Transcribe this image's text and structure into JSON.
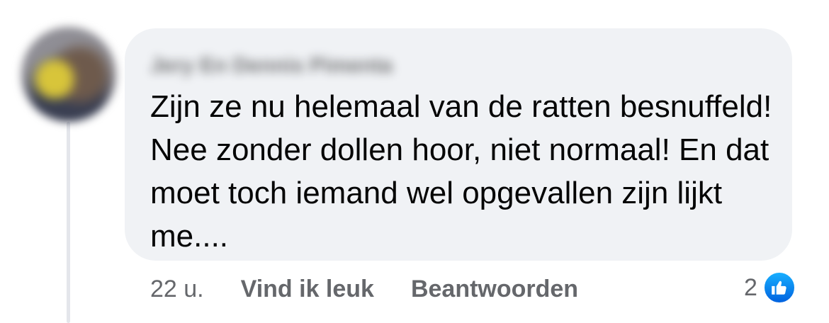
{
  "comment": {
    "author": "Jery En Dennis Pimenta",
    "text": "Zijn ze nu helemaal van de ratten besnuffeld! Nee zonder dollen hoor, niet normaal! En dat moet toch iemand wel opgevallen zijn lijkt me....",
    "timestamp": "22 u.",
    "like_label": "Vind ik leuk",
    "reply_label": "Beantwoorden",
    "reaction_count": "2",
    "reaction_icon": "thumbs-up-icon"
  },
  "colors": {
    "bubble": "#f0f2f5",
    "text": "#050505",
    "secondary_text": "#65676b",
    "like_blue": "#1877f2"
  }
}
